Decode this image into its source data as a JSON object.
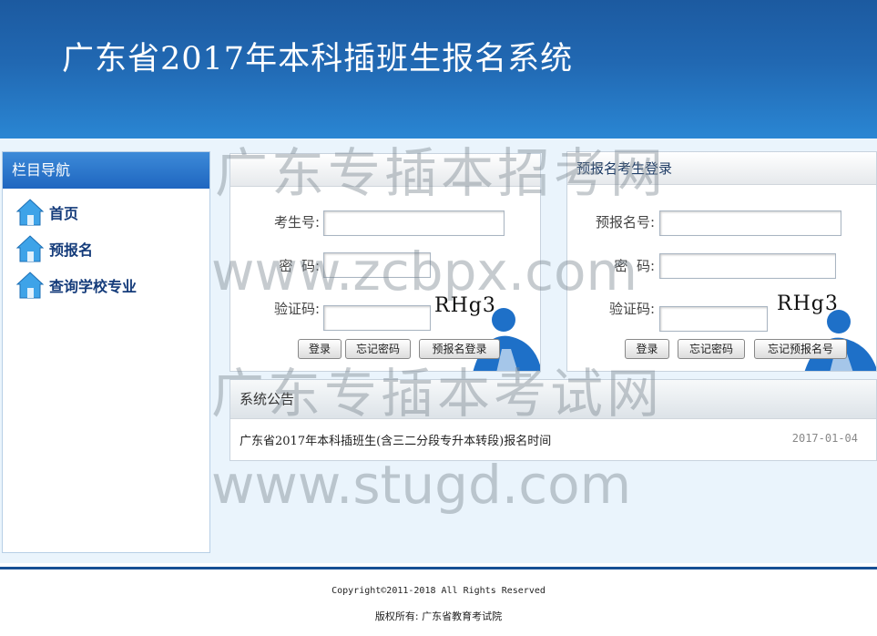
{
  "header": {
    "title": "广东省2017年本科插班生报名系统"
  },
  "sidebar": {
    "title": "栏目导航",
    "items": [
      {
        "label": "首页",
        "icon": "home-icon"
      },
      {
        "label": "预报名",
        "icon": "home-icon"
      },
      {
        "label": "查询学校专业",
        "icon": "home-icon"
      }
    ]
  },
  "login": {
    "title": "",
    "exam_no_label": "考生号:",
    "password_label": "密  码:",
    "captcha_label": "验证码:",
    "captcha_text": "RHg3",
    "buttons": [
      "登录",
      "忘记密码",
      "预报名登录"
    ]
  },
  "prereg_login": {
    "title": "预报名考生登录",
    "prereg_no_label": "预报名号:",
    "password_label": "密  码:",
    "captcha_label": "验证码:",
    "captcha_text": "RHg3",
    "buttons": [
      "登录",
      "忘记密码",
      "忘记预报名号"
    ]
  },
  "notice": {
    "title": "系统公告",
    "items": [
      {
        "title": "广东省2017年本科插班生(含三二分段专升本转段)报名时间",
        "date": "2017-01-04"
      }
    ]
  },
  "watermarks": [
    "广东专插本招考网",
    "www.zcbpx.com",
    "广东专插本考试网",
    "www.stugd.com"
  ],
  "footer": {
    "copyright": "Copyright©2011-2018 All Rights Reserved",
    "owner": "版权所有: 广东省教育考试院"
  },
  "colors": {
    "header_blue": "#2168b2",
    "nav_text": "#143b7a",
    "footer_line": "#174f94"
  }
}
